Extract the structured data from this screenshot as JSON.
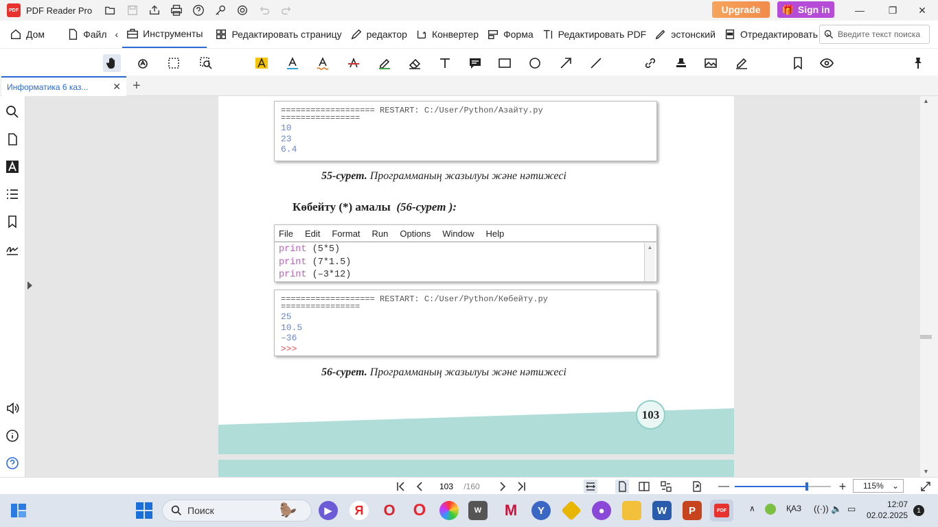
{
  "app": {
    "name": "PDF Reader Pro",
    "logo_text": "PDF",
    "upgrade_label": "Upgrade",
    "signin_label": "Sign in"
  },
  "menu": {
    "items": [
      {
        "label": "Дом"
      },
      {
        "label": "Файл"
      },
      {
        "label": "Инструменты"
      },
      {
        "label": "Редактировать страницу"
      },
      {
        "label": "редактор"
      },
      {
        "label": "Конвертер"
      },
      {
        "label": "Форма"
      },
      {
        "label": "Редактировать PDF"
      },
      {
        "label": "эстонский"
      },
      {
        "label": "Отредактировать"
      }
    ],
    "search_placeholder": "Введите текст поиска"
  },
  "tabs": {
    "doc_title": "Информатика 6 каз...",
    "close": "✕",
    "add": "+"
  },
  "page": {
    "console1": {
      "header": "=================== RESTART: C:/User/Python/Азайту.py",
      "header2": "================",
      "outputs": [
        "10",
        "23",
        "6.4"
      ]
    },
    "caption55_bold": "55-сурет.",
    "caption55_text": "Программаның жазылуы және нәтижесі",
    "heading_bold": "Көбейту (*) амалы",
    "heading_ref": "(56-сурет ):",
    "editor": {
      "menu": [
        "File",
        "Edit",
        "Format",
        "Run",
        "Options",
        "Window",
        "Help"
      ],
      "code": [
        {
          "kw": "print",
          "rest": " (5*5)"
        },
        {
          "kw": "print",
          "rest": " (7*1.5)"
        },
        {
          "kw": "print",
          "rest": " (–3*12)"
        }
      ]
    },
    "console2": {
      "header": "=================== RESTART: C:/User/Python/Көбейту.py",
      "header2": "================",
      "outputs": [
        "25",
        "10.5",
        "–36"
      ],
      "prompt": ">>>"
    },
    "caption56_bold": "56-сурет.",
    "caption56_text": "Программаның жазылуы және нәтижесі",
    "page_number": "103"
  },
  "status": {
    "current_page": "103",
    "total_pages": "/160",
    "zoom": "115%"
  },
  "taskbar": {
    "search_label": "Поиск",
    "lang": "ҚАЗ",
    "time": "12:07",
    "date": "02.02.2025",
    "notifications": "1"
  }
}
